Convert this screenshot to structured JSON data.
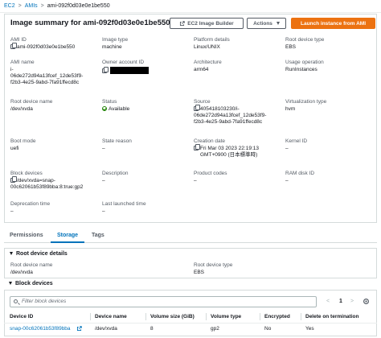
{
  "breadcrumb": {
    "ec2": "EC2",
    "amis": "AMIs",
    "current": "ami-092f0d03e0e1be550",
    "sep": ">"
  },
  "header": {
    "title": "Image summary for ami-092f0d03e0e1be550",
    "btn_builder": "EC2 Image Builder",
    "btn_actions": "Actions",
    "btn_launch": "Launch instance from AMI"
  },
  "fields": {
    "ami_id": {
      "label": "AMI ID",
      "value": "ami-092f0d03e0e1be550"
    },
    "image_type": {
      "label": "Image type",
      "value": "machine"
    },
    "platform": {
      "label": "Platform details",
      "value": "Linux/UNIX"
    },
    "root_device_type": {
      "label": "Root device type",
      "value": "EBS"
    },
    "ami_name": {
      "label": "AMI name",
      "value_lines": [
        "i-",
        "06de272d94a13fcef_12de53f9-",
        "f2b3-4e25-9abd-7fa91ffecd8c"
      ]
    },
    "owner": {
      "label": "Owner account ID"
    },
    "architecture": {
      "label": "Architecture",
      "value": "arm64"
    },
    "usage": {
      "label": "Usage operation",
      "value": "RunInstances"
    },
    "root_device_name": {
      "label": "Root device name",
      "value": "/dev/xvda"
    },
    "status": {
      "label": "Status",
      "value": "Available"
    },
    "source": {
      "label": "Source",
      "value_lines": [
        "405418103230/i-",
        "06de272d94a13fcef_12de53f9-",
        "f2b3-4e25-9abd-7fa91ffecd8c"
      ]
    },
    "virtualization": {
      "label": "Virtualization type",
      "value": "hvm"
    },
    "boot_mode": {
      "label": "Boot mode",
      "value": "uefi"
    },
    "state_reason": {
      "label": "State reason",
      "value": "–"
    },
    "creation_date": {
      "label": "Creation date",
      "value_lines": [
        "Fri Mar 03 2023 22:19:13",
        "GMT+0900 (日本標準時)"
      ]
    },
    "kernel_id": {
      "label": "Kernel ID",
      "value": "–"
    },
    "block_devices": {
      "label": "Block devices",
      "value_lines": [
        "/dev/xvda=snap-",
        "00c62061b53f89bba:8:true:gp2"
      ]
    },
    "description": {
      "label": "Description",
      "value": "–"
    },
    "product_codes": {
      "label": "Product codes",
      "value": "–"
    },
    "ram_disk": {
      "label": "RAM disk ID",
      "value": "–"
    },
    "deprecation": {
      "label": "Deprecation time",
      "value": "–"
    },
    "last_launched": {
      "label": "Last launched time",
      "value": "–"
    }
  },
  "tabs": [
    "Permissions",
    "Storage",
    "Tags"
  ],
  "storage": {
    "root_section": "Root device details",
    "root_name_label": "Root device name",
    "root_name_value": "/dev/xvda",
    "root_type_label": "Root device type",
    "root_type_value": "EBS",
    "block_section": "Block devices",
    "search_placeholder": "Filter block devices",
    "page": "1",
    "prev": "<",
    "next": ">",
    "columns": [
      "Device ID",
      "Device name",
      "Volume size (GiB)",
      "Volume type",
      "Encrypted",
      "Delete on termination"
    ],
    "row": [
      "snap-00c62061b53f89bba",
      "/dev/xvda",
      "8",
      "gp2",
      "No",
      "Yes"
    ]
  }
}
